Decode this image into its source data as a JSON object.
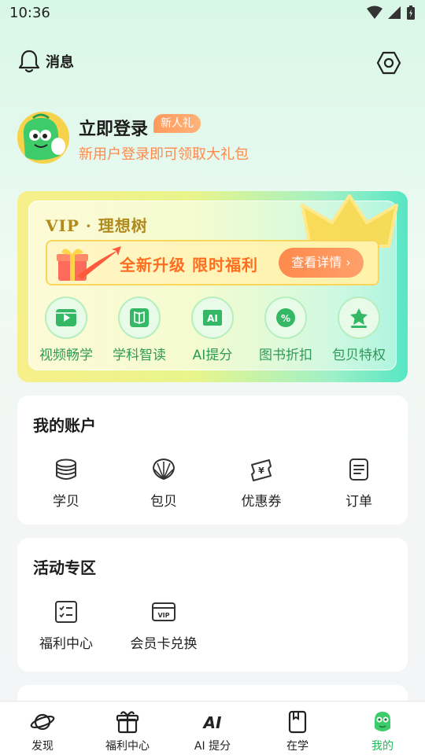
{
  "status_bar": {
    "time": "10:36"
  },
  "top_bar": {
    "messages_label": "消息"
  },
  "profile": {
    "login_title": "立即登录",
    "badge": "新人礼",
    "subtitle": "新用户登录即可领取大礼包"
  },
  "vip": {
    "title": "VIP · 理想树",
    "promo_text": "全新升级 限时福利",
    "detail_button": "查看详情 ›",
    "features": [
      {
        "label": "视频畅学",
        "icon": "video-icon"
      },
      {
        "label": "学科智读",
        "icon": "book-icon"
      },
      {
        "label": "AI提分",
        "icon": "ai-icon"
      },
      {
        "label": "图书折扣",
        "icon": "discount-icon"
      },
      {
        "label": "包贝特权",
        "icon": "privilege-icon"
      }
    ]
  },
  "account": {
    "title": "我的账户",
    "items": [
      {
        "label": "学贝",
        "icon": "coins-icon"
      },
      {
        "label": "包贝",
        "icon": "shell-icon"
      },
      {
        "label": "优惠券",
        "icon": "coupon-icon"
      },
      {
        "label": "订单",
        "icon": "order-icon"
      }
    ]
  },
  "activity": {
    "title": "活动专区",
    "items": [
      {
        "label": "福利中心",
        "icon": "checklist-icon"
      },
      {
        "label": "会员卡兑换",
        "icon": "vip-card-icon"
      }
    ]
  },
  "bottom_nav": {
    "items": [
      {
        "label": "发现",
        "icon": "planet-icon",
        "active": false
      },
      {
        "label": "福利中心",
        "icon": "gift-icon",
        "active": false
      },
      {
        "label": "AI 提分",
        "icon": "ai-logo-icon",
        "active": false
      },
      {
        "label": "在学",
        "icon": "notebook-icon",
        "active": false
      },
      {
        "label": "我的",
        "icon": "mascot-icon",
        "active": true
      }
    ]
  },
  "colors": {
    "accent_green": "#22b85a",
    "accent_orange": "#ff8a4c",
    "vip_gold": "#b08a1c"
  }
}
